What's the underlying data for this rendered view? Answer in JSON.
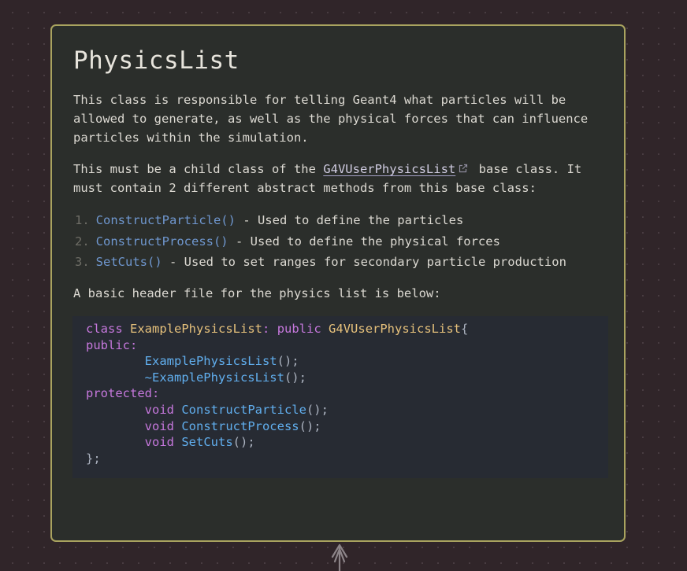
{
  "card": {
    "title": "PhysicsList",
    "paragraph1": "This class is responsible for telling Geant4 what particles will be allowed to generate, as well as the physical forces that can influence particles within the simulation.",
    "paragraph2_before": "This must be a child class of the ",
    "paragraph2_link": "G4VUserPhysicsList",
    "paragraph2_after": " base class. It must contain 2 different abstract methods from this base class:",
    "list": [
      {
        "num": "1.",
        "fn": "ConstructParticle()",
        "desc": " - Used to define the particles"
      },
      {
        "num": "2.",
        "fn": "ConstructProcess()",
        "desc": " - Used to define the physical forces"
      },
      {
        "num": "3.",
        "fn": "SetCuts()",
        "desc": " - Used to set ranges for secondary particle production"
      }
    ],
    "paragraph3": "A basic header file for the physics list is below:",
    "code": {
      "kw_class": "class",
      "class_name": "ExamplePhysicsList",
      "colon_sep": ":",
      "kw_public_inherit": "public",
      "base_class": "G4VUserPhysicsList",
      "open_brace": "{",
      "kw_public": "public",
      "ctor": "ExamplePhysicsList",
      "dtor": "~ExamplePhysicsList",
      "call_end": "();",
      "kw_protected": "protected",
      "kw_void": "void",
      "m1": "ConstructParticle",
      "m2": "ConstructProcess",
      "m3": "SetCuts",
      "close": "};"
    }
  },
  "colors": {
    "background": "#302529",
    "card_border": "#a9a35f",
    "card_bg": "#2b2e2b",
    "code_bg": "#272b33",
    "function_blue": "#6f97cf"
  },
  "icons": [
    "external-link-icon",
    "connector-arrow-icon"
  ]
}
